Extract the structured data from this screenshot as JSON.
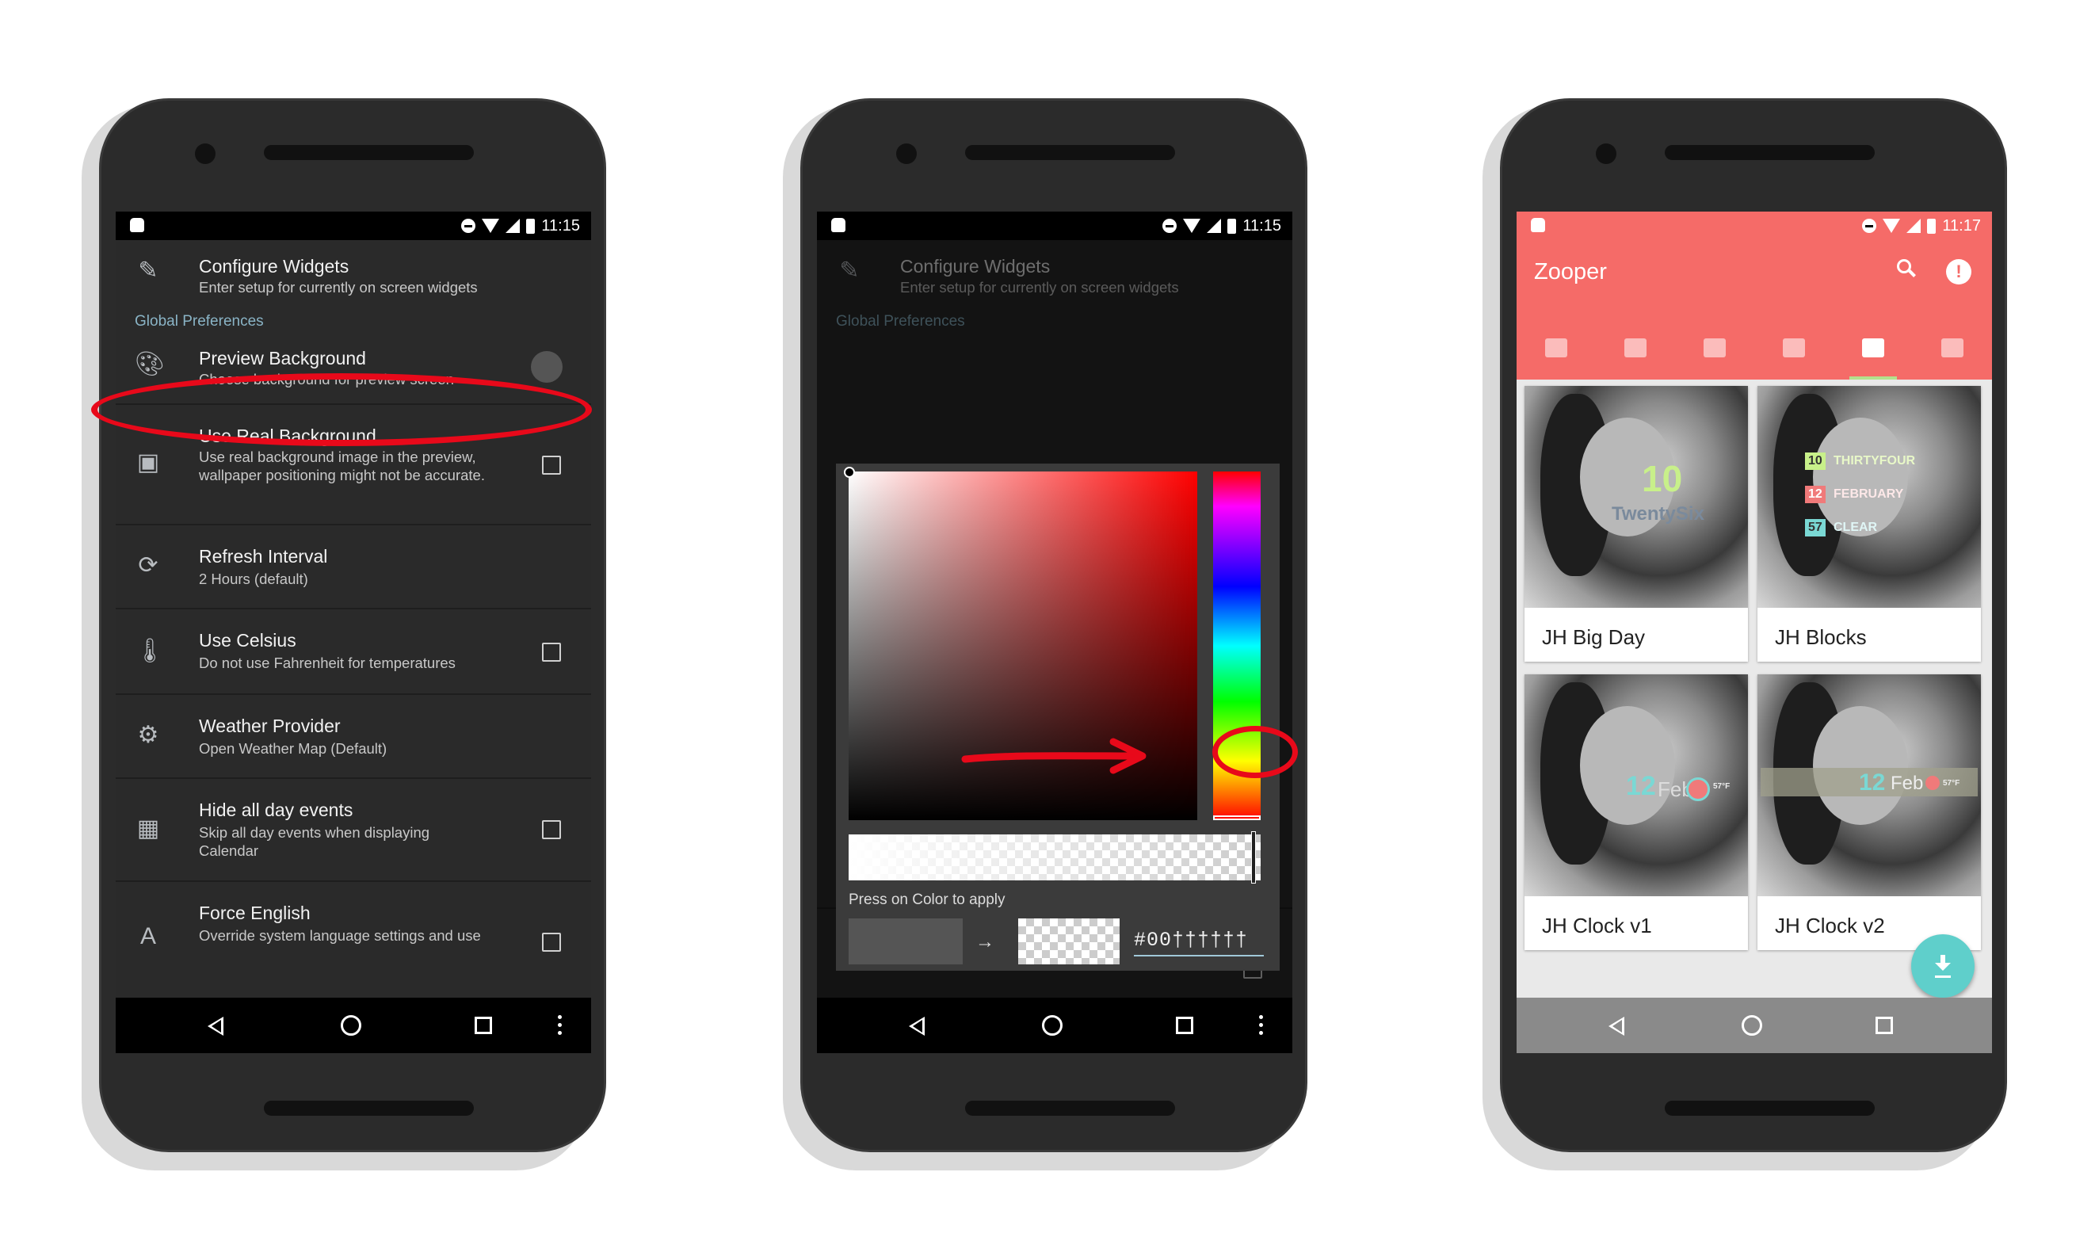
{
  "phones": [
    {
      "status_time": "11:15",
      "items": [
        {
          "title": "Configure Widgets",
          "sub": "Enter setup for currently on screen widgets",
          "icon": "pencil-icon"
        },
        {
          "section": "Global Preferences"
        },
        {
          "title": "Preview Background",
          "sub": "Choose background for preview screen",
          "icon": "palette-icon"
        },
        {
          "title": "Use Real Background",
          "sub": "Use real background image in the preview, wallpaper positioning might not be accurate.",
          "icon": "image-icon"
        },
        {
          "title": "Refresh Interval",
          "sub": "2 Hours (default)",
          "icon": "refresh-icon"
        },
        {
          "title": "Use Celsius",
          "sub": "Do not use Fahrenheit for temperatures",
          "icon": "thermometer-icon"
        },
        {
          "title": "Weather Provider",
          "sub": "Open Weather Map (Default)",
          "icon": "gear-icon"
        },
        {
          "title": "Hide all day events",
          "sub": "Skip all day events when displaying Calendar",
          "icon": "calendar-icon"
        },
        {
          "title": "Force English",
          "sub": "Override system language settings and use",
          "icon": "translate-icon"
        }
      ]
    },
    {
      "status_time": "11:15",
      "dialog": {
        "press_label": "Press on Color to apply",
        "arrow": "→",
        "hex_value": "#00††††††"
      }
    },
    {
      "status_time": "11:17",
      "app_title": "Zooper",
      "tabs": [
        "layers-icon",
        "gallery-icon",
        "mail-icon",
        "share-icon",
        "widgets-icon",
        "people-icon"
      ],
      "cards": [
        {
          "label": "JH Big Day",
          "widget_text": [
            "10",
            "TwentySix"
          ]
        },
        {
          "label": "JH Blocks",
          "widget_text": [
            "10",
            "THIRTYFOUR",
            "12",
            "FEBRUARY",
            "57",
            "CLEAR"
          ]
        },
        {
          "label": "JH Clock v1",
          "widget_text": [
            "12",
            "Feb",
            "57°F"
          ]
        },
        {
          "label": "JH Clock v2",
          "widget_text": [
            "12",
            "Feb",
            "57°F"
          ]
        }
      ]
    }
  ]
}
